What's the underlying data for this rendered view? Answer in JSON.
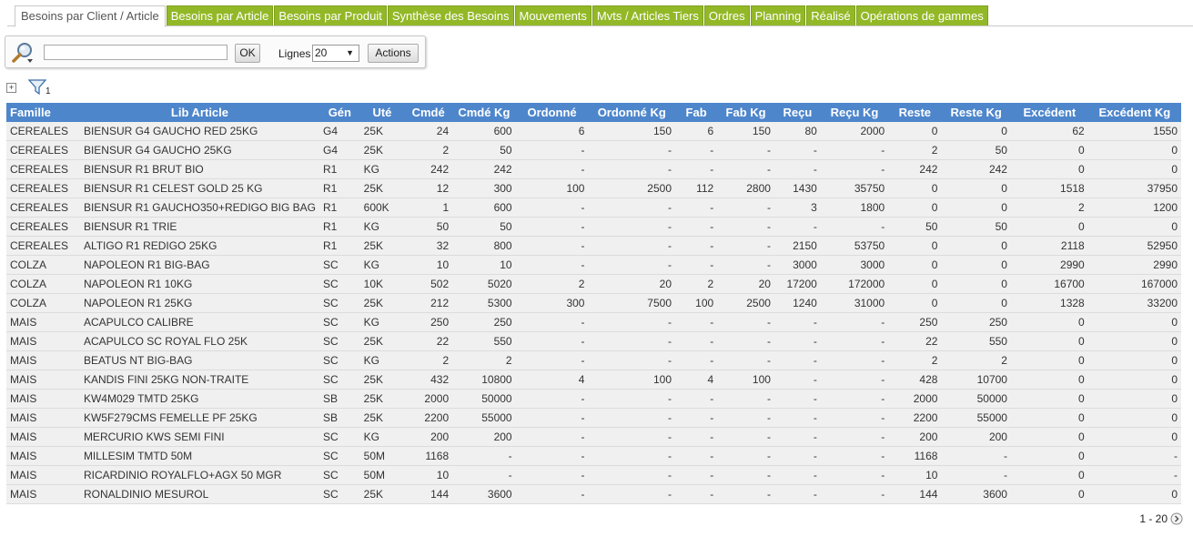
{
  "tabs": [
    {
      "label": "Besoins par Client / Article",
      "active": true
    },
    {
      "label": "Besoins par Article"
    },
    {
      "label": "Besoins par Produit"
    },
    {
      "label": "Synthèse des Besoins"
    },
    {
      "label": "Mouvements"
    },
    {
      "label": "Mvts / Articles Tiers"
    },
    {
      "label": "Ordres"
    },
    {
      "label": "Planning"
    },
    {
      "label": "Réalisé"
    },
    {
      "label": "Opérations de gammes"
    }
  ],
  "toolbar": {
    "search_value": "",
    "ok_label": "OK",
    "lignes_label": "Lignes",
    "lignes_value": "20",
    "actions_label": "Actions"
  },
  "filter": {
    "count": "1"
  },
  "columns": [
    "Famille",
    "Lib Article",
    "Gén",
    "Uté",
    "Cmdé",
    "Cmdé Kg",
    "Ordonné",
    "Ordonné Kg",
    "Fab",
    "Fab Kg",
    "Reçu",
    "Reçu Kg",
    "Reste",
    "Reste Kg",
    "Excédent",
    "Excédent Kg"
  ],
  "rows": [
    [
      "CEREALES",
      "BIENSUR G4 GAUCHO RED 25KG",
      "G4",
      "25K",
      "24",
      "600",
      "6",
      "150",
      "6",
      "150",
      "80",
      "2000",
      "0",
      "0",
      "62",
      "1550"
    ],
    [
      "CEREALES",
      "BIENSUR G4 GAUCHO 25KG",
      "G4",
      "25K",
      "2",
      "50",
      "-",
      "-",
      "-",
      "-",
      "-",
      "-",
      "2",
      "50",
      "0",
      "0"
    ],
    [
      "CEREALES",
      "BIENSUR R1 BRUT BIO",
      "R1",
      "KG",
      "242",
      "242",
      "-",
      "-",
      "-",
      "-",
      "-",
      "-",
      "242",
      "242",
      "0",
      "0"
    ],
    [
      "CEREALES",
      "BIENSUR R1 CELEST GOLD 25 KG",
      "R1",
      "25K",
      "12",
      "300",
      "100",
      "2500",
      "112",
      "2800",
      "1430",
      "35750",
      "0",
      "0",
      "1518",
      "37950"
    ],
    [
      "CEREALES",
      "BIENSUR R1 GAUCHO350+REDIGO BIG BAG",
      "R1",
      "600K",
      "1",
      "600",
      "-",
      "-",
      "-",
      "-",
      "3",
      "1800",
      "0",
      "0",
      "2",
      "1200"
    ],
    [
      "CEREALES",
      "BIENSUR R1 TRIE",
      "R1",
      "KG",
      "50",
      "50",
      "-",
      "-",
      "-",
      "-",
      "-",
      "-",
      "50",
      "50",
      "0",
      "0"
    ],
    [
      "CEREALES",
      "ALTIGO R1 REDIGO 25KG",
      "R1",
      "25K",
      "32",
      "800",
      "-",
      "-",
      "-",
      "-",
      "2150",
      "53750",
      "0",
      "0",
      "2118",
      "52950"
    ],
    [
      "COLZA",
      "NAPOLEON R1 BIG-BAG",
      "SC",
      "KG",
      "10",
      "10",
      "-",
      "-",
      "-",
      "-",
      "3000",
      "3000",
      "0",
      "0",
      "2990",
      "2990"
    ],
    [
      "COLZA",
      "NAPOLEON R1 10KG",
      "SC",
      "10K",
      "502",
      "5020",
      "2",
      "20",
      "2",
      "20",
      "17200",
      "172000",
      "0",
      "0",
      "16700",
      "167000"
    ],
    [
      "COLZA",
      "NAPOLEON R1 25KG",
      "SC",
      "25K",
      "212",
      "5300",
      "300",
      "7500",
      "100",
      "2500",
      "1240",
      "31000",
      "0",
      "0",
      "1328",
      "33200"
    ],
    [
      "MAIS",
      "ACAPULCO CALIBRE",
      "SC",
      "KG",
      "250",
      "250",
      "-",
      "-",
      "-",
      "-",
      "-",
      "-",
      "250",
      "250",
      "0",
      "0"
    ],
    [
      "MAIS",
      "ACAPULCO SC ROYAL FLO 25K",
      "SC",
      "25K",
      "22",
      "550",
      "-",
      "-",
      "-",
      "-",
      "-",
      "-",
      "22",
      "550",
      "0",
      "0"
    ],
    [
      "MAIS",
      "BEATUS NT BIG-BAG",
      "SC",
      "KG",
      "2",
      "2",
      "-",
      "-",
      "-",
      "-",
      "-",
      "-",
      "2",
      "2",
      "0",
      "0"
    ],
    [
      "MAIS",
      "KANDIS FINI 25KG NON-TRAITE",
      "SC",
      "25K",
      "432",
      "10800",
      "4",
      "100",
      "4",
      "100",
      "-",
      "-",
      "428",
      "10700",
      "0",
      "0"
    ],
    [
      "MAIS",
      "KW4M029 TMTD 25KG",
      "SB",
      "25K",
      "2000",
      "50000",
      "-",
      "-",
      "-",
      "-",
      "-",
      "-",
      "2000",
      "50000",
      "0",
      "0"
    ],
    [
      "MAIS",
      "KW5F279CMS FEMELLE PF 25KG",
      "SB",
      "25K",
      "2200",
      "55000",
      "-",
      "-",
      "-",
      "-",
      "-",
      "-",
      "2200",
      "55000",
      "0",
      "0"
    ],
    [
      "MAIS",
      "MERCURIO KWS SEMI FINI",
      "SC",
      "KG",
      "200",
      "200",
      "-",
      "-",
      "-",
      "-",
      "-",
      "-",
      "200",
      "200",
      "0",
      "0"
    ],
    [
      "MAIS",
      "MILLESIM TMTD 50M",
      "SC",
      "50M",
      "1168",
      "-",
      "-",
      "-",
      "-",
      "-",
      "-",
      "-",
      "1168",
      "-",
      "0",
      "-"
    ],
    [
      "MAIS",
      "RICARDINIO ROYALFLO+AGX 50 MGR",
      "SC",
      "50M",
      "10",
      "-",
      "-",
      "-",
      "-",
      "-",
      "-",
      "-",
      "10",
      "-",
      "0",
      "-"
    ],
    [
      "MAIS",
      "RONALDINIO MESUROL",
      "SC",
      "25K",
      "144",
      "3600",
      "-",
      "-",
      "-",
      "-",
      "-",
      "-",
      "144",
      "3600",
      "0",
      "0"
    ]
  ],
  "pager": {
    "label": "1 - 20"
  }
}
